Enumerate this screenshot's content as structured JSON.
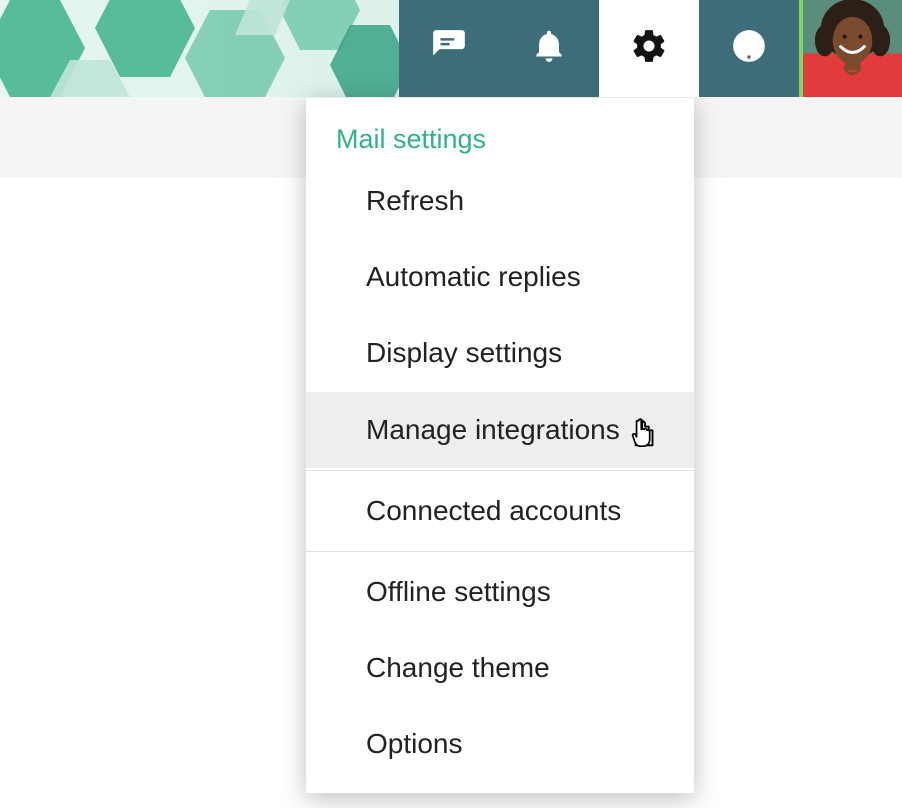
{
  "header": {
    "chat_icon": "chat-icon",
    "bell_icon": "bell-icon",
    "gear_icon": "gear-icon",
    "help_icon": "help-icon"
  },
  "settings_menu": {
    "title": "Mail settings",
    "items": [
      {
        "label": "Refresh"
      },
      {
        "label": "Automatic replies"
      },
      {
        "label": "Display settings"
      },
      {
        "label": "Manage integrations",
        "hovered": true,
        "divider_after": true
      },
      {
        "label": "Connected accounts",
        "divider_after": true
      },
      {
        "label": "Offline settings"
      },
      {
        "label": "Change theme"
      },
      {
        "label": "Options"
      }
    ]
  }
}
